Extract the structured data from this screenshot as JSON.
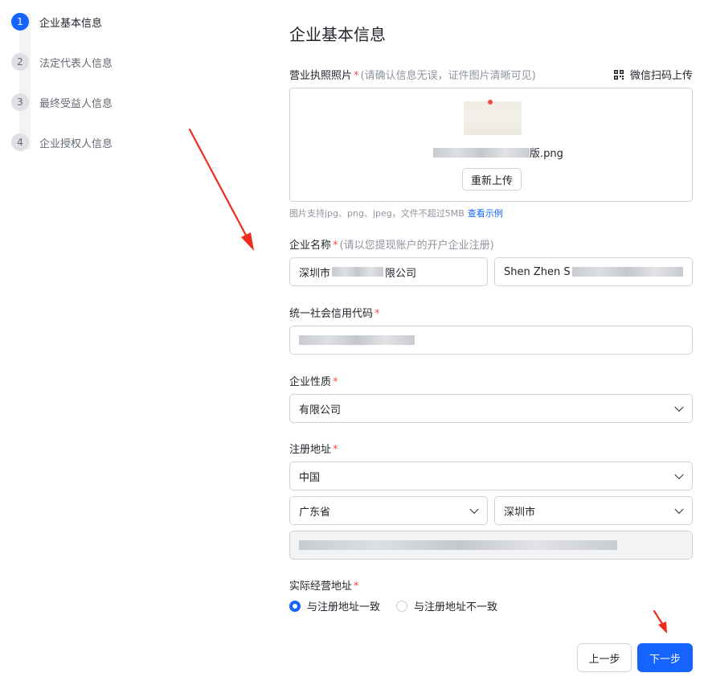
{
  "steps": [
    {
      "num": "1",
      "label": "企业基本信息",
      "active": true
    },
    {
      "num": "2",
      "label": "法定代表人信息",
      "active": false
    },
    {
      "num": "3",
      "label": "最终受益人信息",
      "active": false
    },
    {
      "num": "4",
      "label": "企业授权人信息",
      "active": false
    }
  ],
  "form": {
    "title": "企业基本信息",
    "license": {
      "label": "营业执照照片",
      "required": "*",
      "hint": "(请确认信息无误，证件图片清晰可见)",
      "wechat_upload": "微信扫码上传",
      "file_suffix": "版.png",
      "reupload": "重新上传",
      "tip": "图片支持jpg、png、jpeg，文件不超过5MB",
      "tip_link": "查看示例"
    },
    "company_name": {
      "label": "企业名称",
      "required": "*",
      "hint": "(请以您提现账户的开户企业注册)",
      "cn_prefix": "深圳市",
      "cn_suffix": "限公司",
      "en_prefix": "Shen Zhen S"
    },
    "credit_code": {
      "label": "统一社会信用代码",
      "required": "*"
    },
    "company_type": {
      "label": "企业性质",
      "required": "*",
      "value": "有限公司"
    },
    "reg_address": {
      "label": "注册地址",
      "required": "*",
      "country": "中国",
      "province": "广东省",
      "city": "深圳市"
    },
    "biz_address": {
      "label": "实际经营地址",
      "required": "*",
      "options": [
        {
          "label": "与注册地址一致",
          "checked": true
        },
        {
          "label": "与注册地址不一致",
          "checked": false
        }
      ]
    },
    "buttons": {
      "prev": "上一步",
      "next": "下一步"
    }
  },
  "colors": {
    "primary": "#1664ff",
    "required": "#f54a45",
    "annotation_arrow": "#ee2b1c"
  }
}
